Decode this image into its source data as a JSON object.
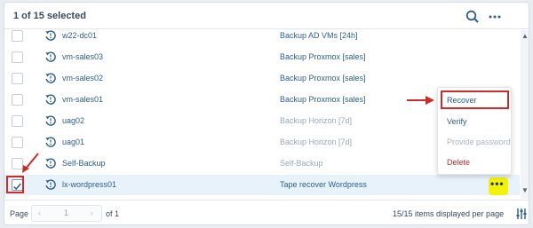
{
  "header": {
    "selection": "1 of 15 selected"
  },
  "rows": [
    {
      "name": "w22-dc01",
      "job": "Backup AD VMs [24h]",
      "muted": false
    },
    {
      "name": "vm-sales03",
      "job": "Backup Proxmox [sales]",
      "muted": false
    },
    {
      "name": "vm-sales02",
      "job": "Backup Proxmox [sales]",
      "muted": false
    },
    {
      "name": "vm-sales01",
      "job": "Backup Proxmox [sales]",
      "muted": false
    },
    {
      "name": "uag02",
      "job": "Backup Horizon [7d]",
      "muted": true
    },
    {
      "name": "uag01",
      "job": "Backup Horizon [7d]",
      "muted": true
    },
    {
      "name": "Self-Backup",
      "job": "Self-Backup",
      "muted": true
    },
    {
      "name": "lx-wordpress01",
      "job": "Tape recover Wordpress",
      "muted": false,
      "selected": true
    }
  ],
  "context_menu": {
    "recover": "Recover",
    "verify": "Verify",
    "provide_password": "Provide password",
    "delete": "Delete"
  },
  "footer": {
    "page_label": "Page",
    "page_value": "1",
    "of_pages": "of 1",
    "items_displayed": "15/15 items displayed per page"
  },
  "colors": {
    "accent": "#2c5e8f",
    "danger": "#cf2b2b",
    "highlight": "#f2f20a"
  }
}
